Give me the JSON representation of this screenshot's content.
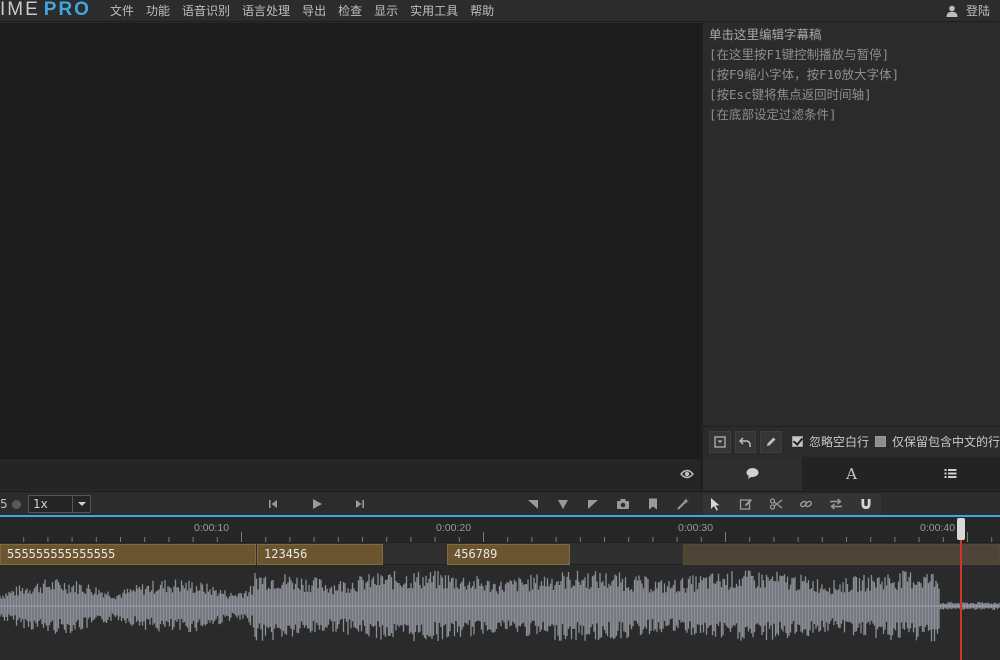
{
  "app": {
    "logo_text": "IME",
    "logo_pro": "PRO"
  },
  "menu": {
    "items": [
      "文件",
      "功能",
      "语音识别",
      "语言处理",
      "导出",
      "检查",
      "显示",
      "实用工具",
      "帮助"
    ],
    "login_label": "登陆"
  },
  "editor": {
    "lines": [
      "单击这里编辑字幕稿",
      "[在这里按F1键控制播放与暂停]",
      "[按F9缩小字体，按F10放大字体]",
      "[按Esc键将焦点返回时间轴]",
      "[在底部设定过滤条件]"
    ],
    "ignore_blank_label": "忽略空白行",
    "ignore_blank_checked": true,
    "keep_chinese_label": "仅保留包含中文的行",
    "keep_chinese_checked": false
  },
  "editor_tabs": [
    "comment-icon",
    "font-icon",
    "list-icon"
  ],
  "transport": {
    "frame_number": "5",
    "speed_value": "1x"
  },
  "ruler": {
    "labels": [
      "0:00:10",
      "0:00:20",
      "0:00:30",
      "0:00:40"
    ]
  },
  "track": {
    "segments": [
      {
        "text": "555555555555555"
      },
      {
        "text": "123456"
      },
      {
        "text": "456789"
      }
    ]
  },
  "colors": {
    "accent": "#3da7e0",
    "segment": "#6a5530",
    "playhead": "#d0342c",
    "waveform": "#8b8f95"
  }
}
